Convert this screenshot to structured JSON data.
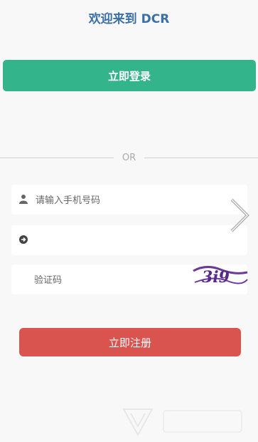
{
  "header": {
    "title": "欢迎来到 DCR"
  },
  "login": {
    "button_label": "立即登录"
  },
  "divider": {
    "label": "OR"
  },
  "form": {
    "phone": {
      "value": "",
      "placeholder": "请输入手机号码"
    },
    "password": {
      "value": "",
      "placeholder": ""
    },
    "captcha": {
      "value": "",
      "placeholder": "验证码",
      "image_text": "3i9"
    }
  },
  "register": {
    "button_label": "立即注册"
  },
  "colors": {
    "title": "#3a6fa8",
    "login_button": "#34b48b",
    "register_button": "#d9534f"
  },
  "icons": [
    "user-icon",
    "arrow-right-circle-icon",
    "chevron-right-icon"
  ]
}
